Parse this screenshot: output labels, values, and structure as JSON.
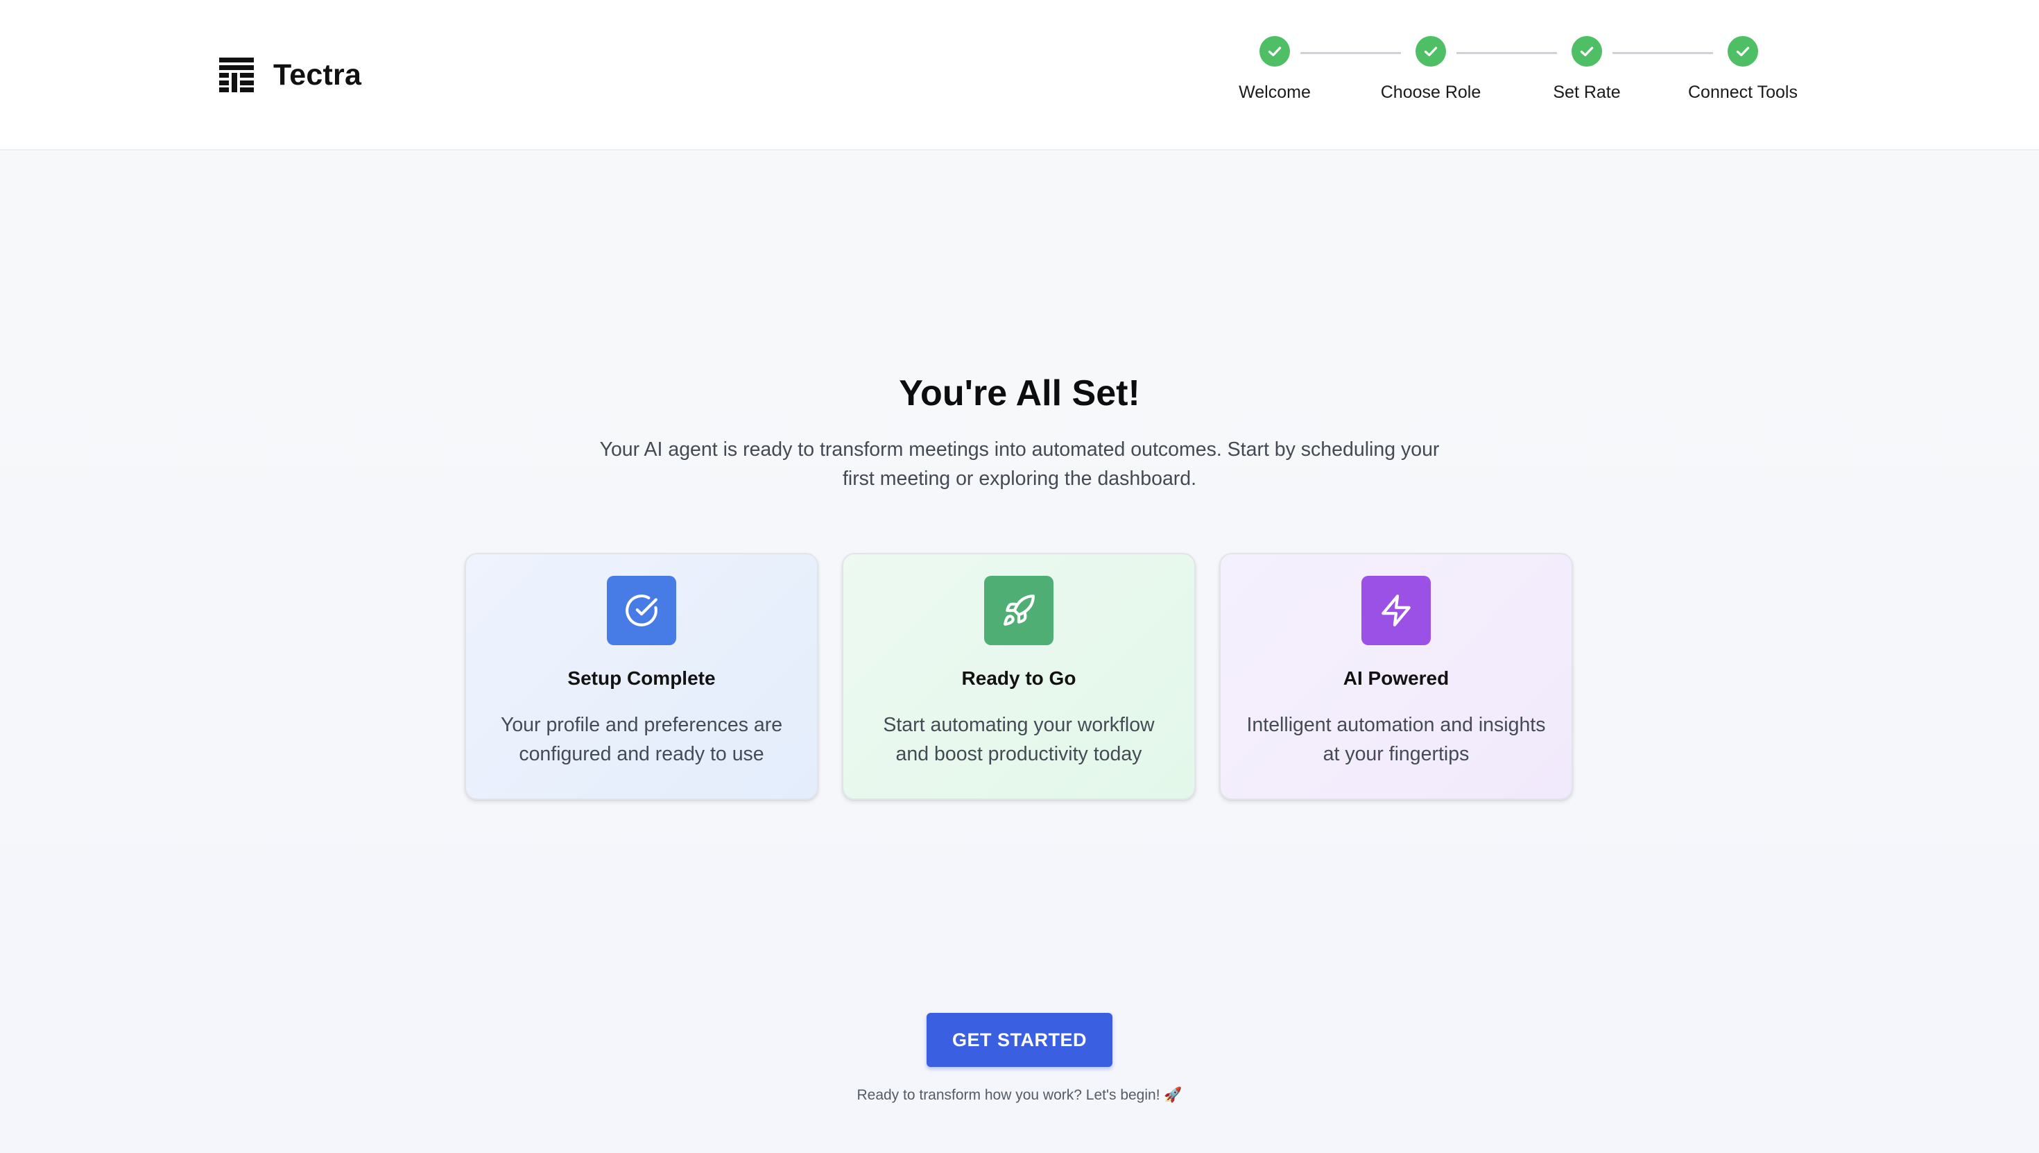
{
  "app": {
    "name": "Tectra"
  },
  "stepper": {
    "steps": [
      {
        "label": "Welcome",
        "status": "complete"
      },
      {
        "label": "Choose Role",
        "status": "complete"
      },
      {
        "label": "Set Rate",
        "status": "complete"
      },
      {
        "label": "Connect Tools",
        "status": "complete"
      }
    ]
  },
  "main": {
    "title": "You're All Set!",
    "subtitle": "Your AI agent is ready to transform meetings into automated outcomes. Start by scheduling your first meeting or exploring the dashboard.",
    "cards": [
      {
        "icon": "check-circle-icon",
        "title": "Setup Complete",
        "description": "Your profile and preferences are configured and ready to use",
        "color": "#477ce6"
      },
      {
        "icon": "rocket-icon",
        "title": "Ready to Go",
        "description": "Start automating your workflow and boost productivity today",
        "color": "#4fae74"
      },
      {
        "icon": "lightning-icon",
        "title": "AI Powered",
        "description": "Intelligent automation and insights at your fingertips",
        "color": "#9b50e6"
      }
    ],
    "cta_label": "GET STARTED",
    "footnote": "Ready to transform how you work? Let's begin! 🚀"
  },
  "colors": {
    "step_complete": "#4fbf65",
    "cta": "#3a5fe0"
  }
}
